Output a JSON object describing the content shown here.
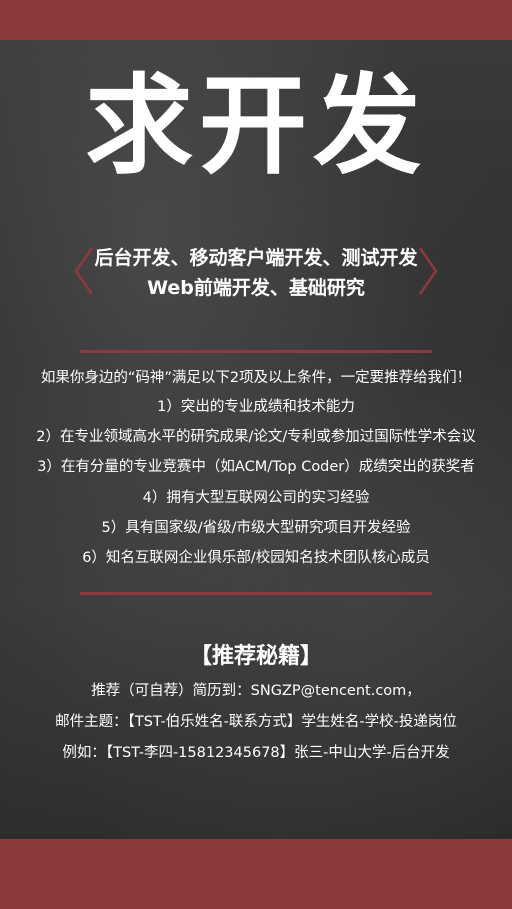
{
  "poster": {
    "title": "求开发",
    "subtitle_line1": "后台开发、移动客户端开发、测试开发",
    "subtitle_line2": "Web前端开发、基础研究",
    "intro": "如果你身边的“码神”满足以下2项及以上条件，一定要推荐给我们！",
    "conditions": [
      "1）突出的专业成绩和技术能力",
      "2）在专业领域高水平的研究成果/论文/专利或参加过国际性学术会议",
      "3）在有分量的专业竞赛中（如ACM/Top Coder）成绩突出的获奖者",
      "4）拥有大型互联网公司的实习经验",
      "5）具有国家级/省级/市级大型研究项目开发经验",
      "6）知名互联网企业俱乐部/校园知名技术团队核心成员"
    ],
    "recommend_title": "【推荐秘籍】",
    "recommend_lines": [
      "推荐（可自荐）简历到：SNGZP@tencent.com，",
      "邮件主题：【TST-伯乐姓名-联系方式】学生姓名-学校-投递岗位",
      "例如：【TST-李四-15812345678】张三-中山大学-后台开发"
    ]
  },
  "colors": {
    "accent": "#8c3a3d",
    "text": "#ffffff",
    "background": "#2e2e2e"
  }
}
